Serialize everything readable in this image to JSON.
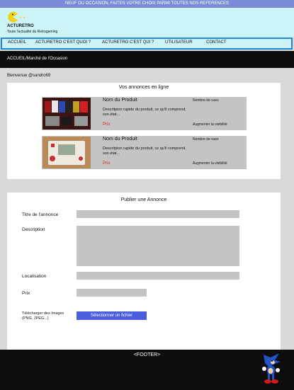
{
  "topbar": {
    "text": "NEUF OU OCCASION, FAITES VOTRE CHOIX PARMI TOUTES NOS REFERENCES"
  },
  "logo": {
    "title": "ACTURETRO",
    "subtitle": "Toute l'actualité du Retrogaming",
    "icon": "pacman-icon"
  },
  "nav": [
    "ACCUEIL",
    "ACTURETRO C'EST QUOI ?",
    "ACTURETRO C'EST QUI ?",
    "UTILISATEUR",
    "CONTACT"
  ],
  "breadcrumb": "ACCUEIL/Marché de l'Occasion",
  "welcome": "Bienvenue @sandro69",
  "ads": {
    "title": "Vos annonces en ligne",
    "items": [
      {
        "name": "Nom du Produit",
        "description": "Descritpion rapide du produit, ce qu'il comprend, son état...",
        "price": "Prix",
        "views": "Nombre de vues",
        "boost": "Augmenter la visibilité",
        "image": "nes-games-photo"
      },
      {
        "name": "Nom du Produit",
        "description": "Descritpion rapide du produit, ce qu'il comprend, son état...",
        "price": "Prix",
        "views": "Nombre de vues",
        "boost": "Augmenter la visibilité",
        "image": "game-and-watch-photo"
      }
    ]
  },
  "form": {
    "title": "Publier une Annonce",
    "title_label": "Titre de l'annonce",
    "description_label": "Description",
    "location_label": "Localisation",
    "price_label": "Prix",
    "upload_label": "Télécharger des Images (PNG, JPEG...)",
    "upload_button": "Sélectionner un fichier"
  },
  "footer": {
    "label": "<FOOTER>",
    "mascot": "sonic-mascot-icon"
  },
  "colors": {
    "topbar": "#7b8cd6",
    "header": "#ccf3f5",
    "nav_border": "#1e8ad6",
    "dark": "#0d0d0d",
    "price": "#e02020",
    "button": "#4a5ddb",
    "card": "#c4c4c4"
  }
}
